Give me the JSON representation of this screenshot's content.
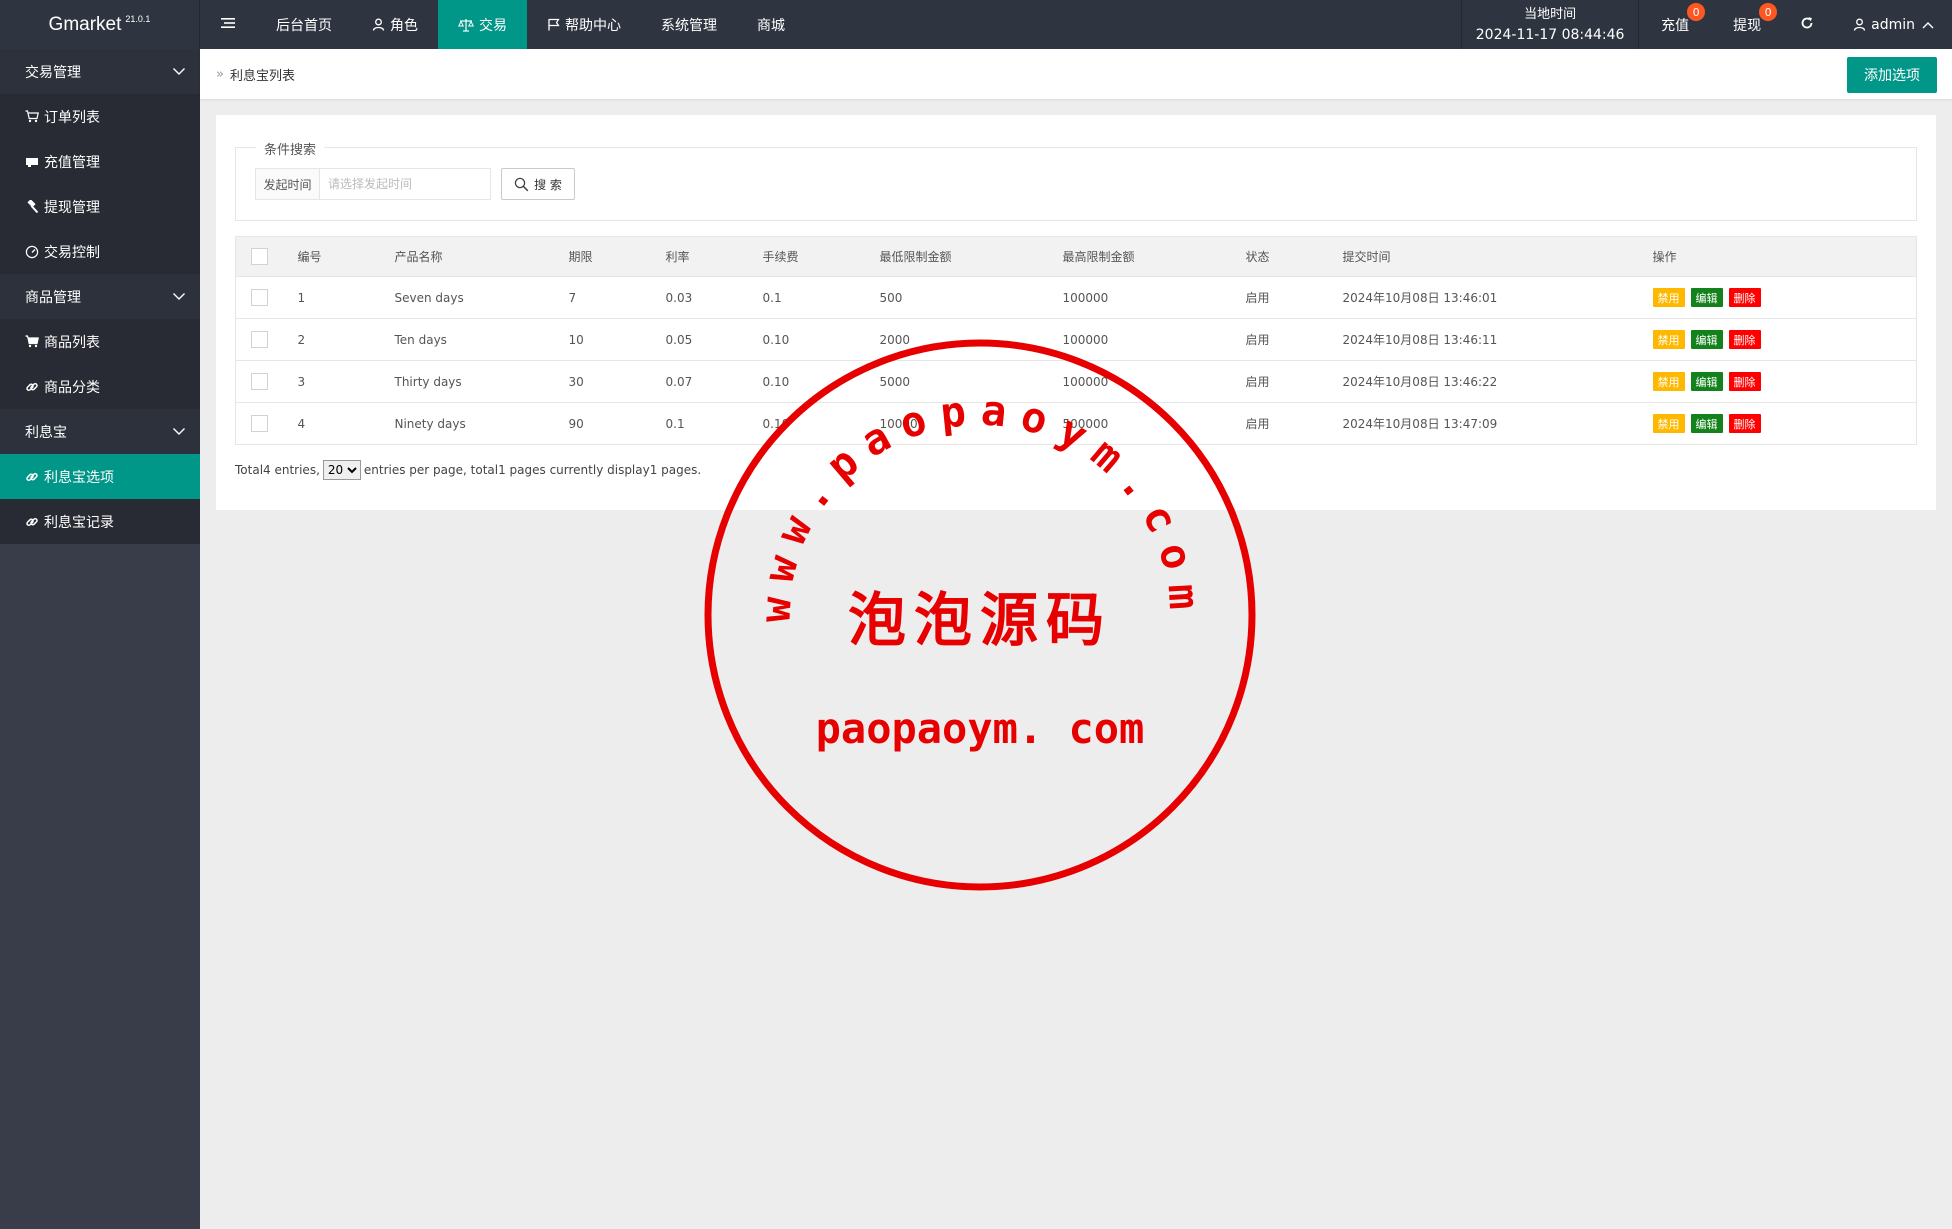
{
  "brand": {
    "name": "Gmarket",
    "version": "21.0.1"
  },
  "nav": {
    "toggle_icon": "hamburger-icon",
    "items": [
      {
        "label": "后台首页",
        "icon": ""
      },
      {
        "label": "角色",
        "icon": "user-icon"
      },
      {
        "label": "交易",
        "icon": "scale-icon",
        "active": true
      },
      {
        "label": "帮助中心",
        "icon": "flag-icon"
      },
      {
        "label": "系统管理",
        "icon": ""
      },
      {
        "label": "商城",
        "icon": ""
      }
    ]
  },
  "topright": {
    "clock_label": "当地时间",
    "clock_time": "2024-11-17 08:44:46",
    "recharge_label": "充值",
    "recharge_badge": "0",
    "withdraw_label": "提现",
    "withdraw_badge": "0",
    "refresh_icon": "refresh-icon",
    "user_label": "admin"
  },
  "sidebar": {
    "groups": [
      {
        "label": "交易管理",
        "items": [
          {
            "label": "订单列表",
            "icon": "cart-icon"
          },
          {
            "label": "充值管理",
            "icon": "card-icon"
          },
          {
            "label": "提现管理",
            "icon": "hammer-icon"
          },
          {
            "label": "交易控制",
            "icon": "gauge-icon"
          }
        ]
      },
      {
        "label": "商品管理",
        "items": [
          {
            "label": "商品列表",
            "icon": "cart-icon"
          },
          {
            "label": "商品分类",
            "icon": "link-icon"
          }
        ]
      },
      {
        "label": "利息宝",
        "items": [
          {
            "label": "利息宝选项",
            "icon": "link-icon",
            "active": true
          },
          {
            "label": "利息宝记录",
            "icon": "link-icon"
          }
        ]
      }
    ]
  },
  "breadcrumb": {
    "current": "利息宝列表"
  },
  "add_button": "添加选项",
  "search": {
    "legend": "条件搜索",
    "field_label": "发起时间",
    "field_placeholder": "请选择发起时间",
    "button_label": "搜 索"
  },
  "table": {
    "headers": [
      "编号",
      "产品名称",
      "期限",
      "利率",
      "手续费",
      "最低限制金额",
      "最高限制金额",
      "状态",
      "提交时间",
      "操作"
    ],
    "rows": [
      [
        "1",
        "Seven days",
        "7",
        "0.03",
        "0.1",
        "500",
        "100000",
        "启用",
        "2024年10月08日 13:46:01"
      ],
      [
        "2",
        "Ten days",
        "10",
        "0.05",
        "0.10",
        "2000",
        "100000",
        "启用",
        "2024年10月08日 13:46:11"
      ],
      [
        "3",
        "Thirty days",
        "30",
        "0.07",
        "0.10",
        "5000",
        "100000",
        "启用",
        "2024年10月08日 13:46:22"
      ],
      [
        "4",
        "Ninety days",
        "90",
        "0.1",
        "0.10",
        "10000",
        "500000",
        "启用",
        "2024年10月08日 13:47:09"
      ]
    ],
    "actions": {
      "ban": "禁用",
      "edit": "编辑",
      "delete": "删除"
    }
  },
  "pager": {
    "prefix": "Total4 entries,",
    "per_page": "20",
    "suffix": "entries per page, total1 pages currently display1 pages."
  },
  "watermark": {
    "url_arc": "www.paopaoym.com",
    "center_text": "泡泡源码",
    "bottom_text": "paopaoym. com",
    "color": "#e60000"
  },
  "colors": {
    "accent": "#009688",
    "topbar": "#2f3540",
    "sidebar": "#393d49",
    "badge": "#ff5722",
    "ban": "#ffb800",
    "edit": "#14821c",
    "delete": "#ff0000"
  }
}
